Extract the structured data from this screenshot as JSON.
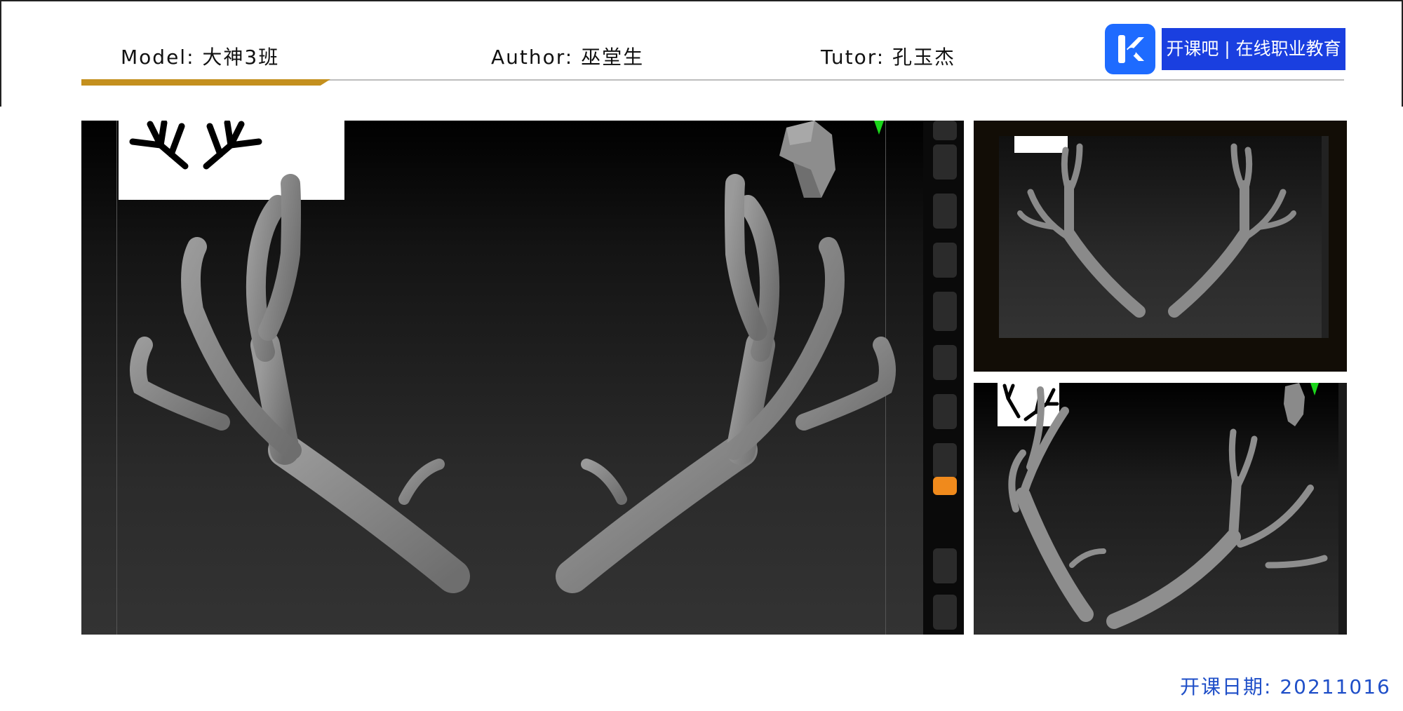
{
  "header": {
    "model": "Model:  大神3班",
    "author": "Author: 巫堂生",
    "tutor": "Tutor: 孔玉杰"
  },
  "logo": {
    "icon_name": "kaikeba-k-logo-icon",
    "banner_text": "开课吧 | 在线职业教育"
  },
  "footer": {
    "date": "开课日期: 20211016"
  },
  "colors": {
    "accent_bar": "#c4901e",
    "logo_blue": "#1e6bff",
    "banner_blue": "#1a3fe0",
    "date_blue": "#1f4fc8",
    "active_tool": "#f08a1c"
  }
}
